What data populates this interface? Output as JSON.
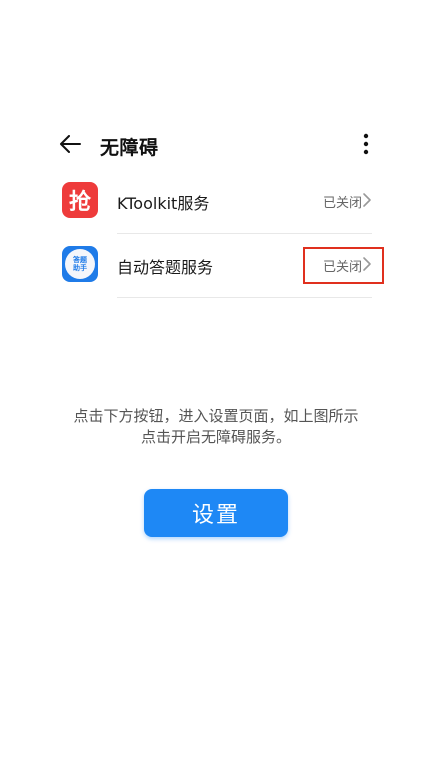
{
  "header": {
    "title": "无障碍",
    "back_icon": "arrow-left-icon",
    "more_icon": "more-vertical-icon"
  },
  "services": [
    {
      "label": "KToolkit服务",
      "status": "已关闭",
      "icon": "ktoolkit-app-icon",
      "icon_glyph": "抢",
      "icon_color": "#ee3b3b"
    },
    {
      "label": "自动答题服务",
      "status": "已关闭",
      "icon": "auto-answer-app-icon",
      "icon_glyph": "答题助手",
      "icon_color": "#1f7be8",
      "highlighted": true,
      "highlight_color": "#e0301e"
    }
  ],
  "instructions": {
    "line1": "点击下方按钮，进入设置页面，如上图所示",
    "line2": "点击开启无障碍服务。"
  },
  "setup_button": {
    "label": "设置",
    "color": "#1e88f5"
  }
}
